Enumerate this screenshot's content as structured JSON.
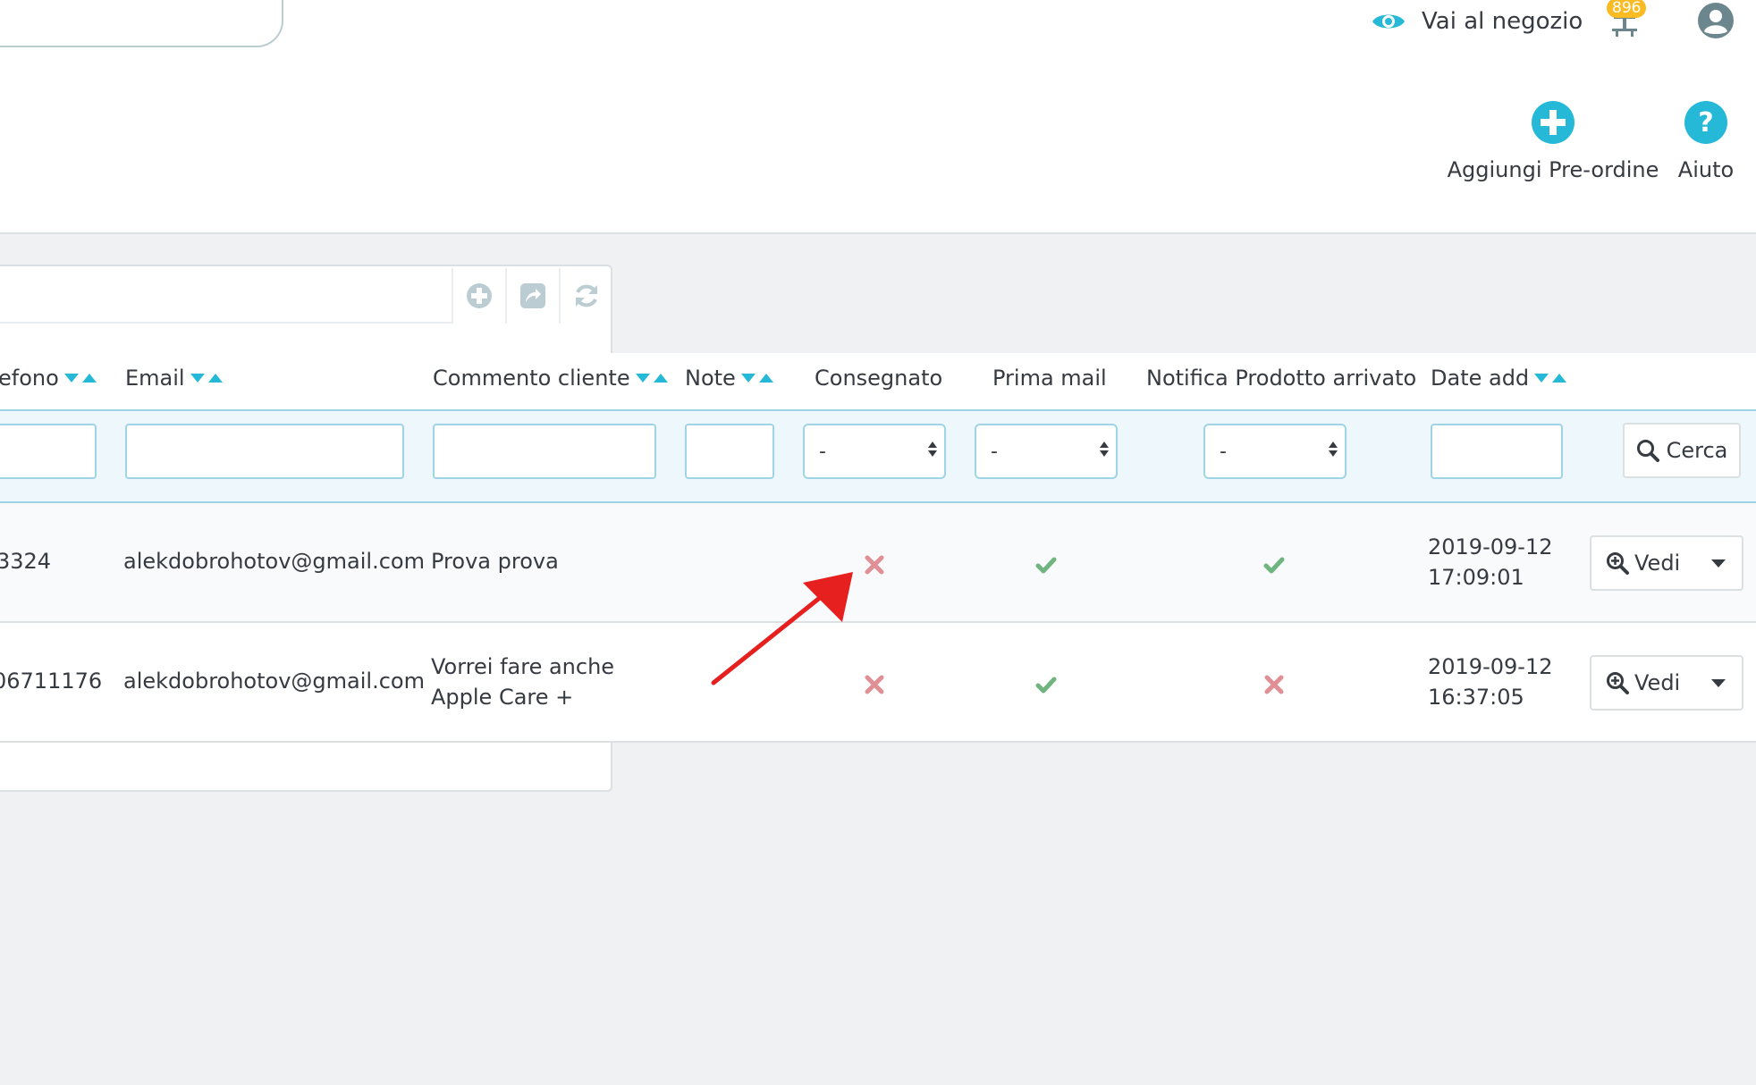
{
  "header": {
    "shop_link_label": "Vai al negozio",
    "notification_count": "896"
  },
  "toolbar": {
    "add_preorder_label": "Aggiungi Pre-ordine",
    "help_label": "Aiuto"
  },
  "table": {
    "columns": [
      {
        "label": "efono",
        "sortable": true
      },
      {
        "label": "Email",
        "sortable": true
      },
      {
        "label": "Commento cliente",
        "sortable": true
      },
      {
        "label": "Note",
        "sortable": true
      },
      {
        "label": "Consegnato",
        "sortable": false
      },
      {
        "label": "Prima mail",
        "sortable": false
      },
      {
        "label": "Notifica Prodotto arrivato",
        "sortable": false
      },
      {
        "label": "Date add",
        "sortable": true
      }
    ],
    "filters": {
      "select_default": "-",
      "search_button_label": "Cerca"
    },
    "rows": [
      {
        "phone": "3324",
        "email": "alekdobrohotov@gmail.com",
        "comment_line1": "Prova prova",
        "comment_line2": "",
        "note": "",
        "delivered": false,
        "first_mail": true,
        "product_arrived_notice": true,
        "date": "2019-09-12",
        "time": "17:09:01",
        "view_label": "Vedi"
      },
      {
        "phone": "06711176",
        "email": "alekdobrohotov@gmail.com",
        "comment_line1": "Vorrei fare anche",
        "comment_line2": "Apple Care +",
        "note": "",
        "delivered": false,
        "first_mail": true,
        "product_arrived_notice": false,
        "date": "2019-09-12",
        "time": "16:37:05",
        "view_label": "Vedi"
      }
    ]
  },
  "colors": {
    "accent": "#25b9d7",
    "check": "#70b580",
    "cross": "#e08f95",
    "annotation": "#e5201f",
    "badge": "#fbbb22"
  }
}
